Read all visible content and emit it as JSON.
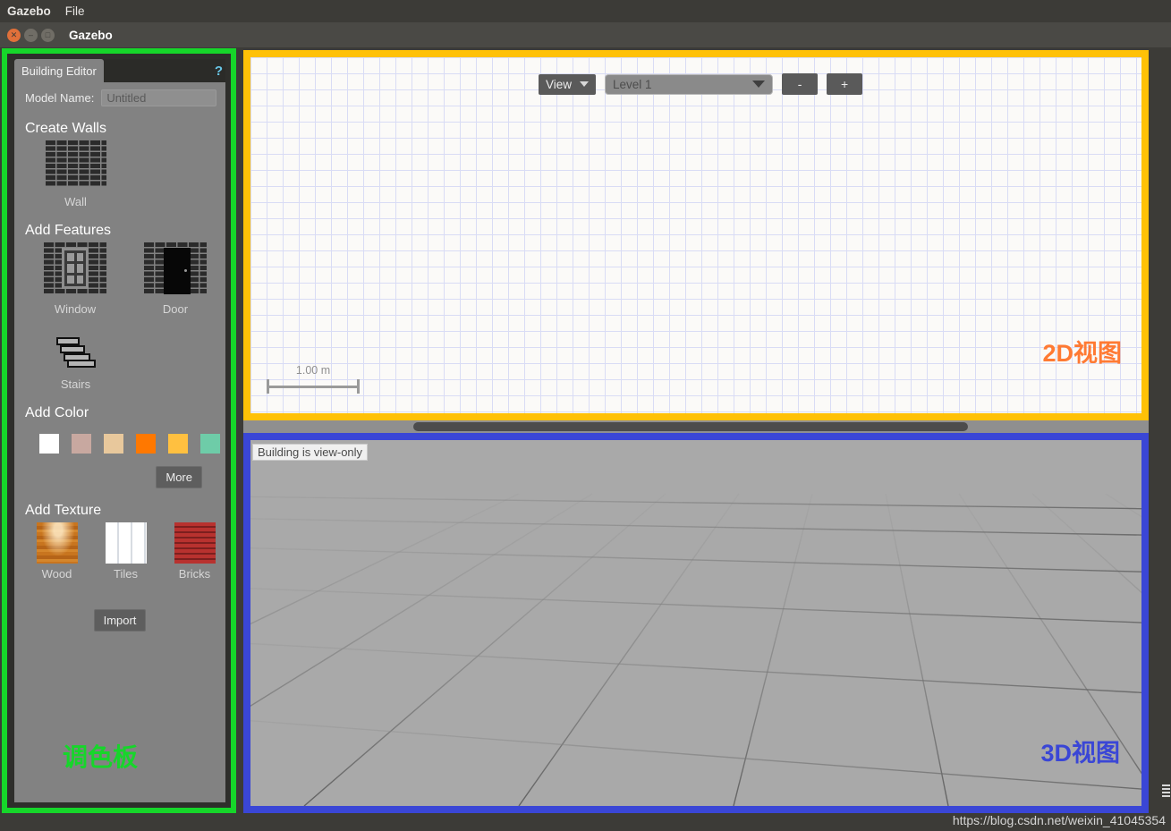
{
  "menubar": {
    "app": "Gazebo",
    "file": "File"
  },
  "window": {
    "title": "Gazebo",
    "close_icon": "close-icon",
    "minimize_icon": "minimize-icon",
    "maximize_icon": "maximize-icon"
  },
  "palette": {
    "tab_label": "Building Editor",
    "help_icon": "?",
    "model_name_label": "Model Name:",
    "model_name_value": "Untitled",
    "annotation": "调色板",
    "annotation_color": "#16d62a",
    "sections": {
      "create_walls": {
        "heading": "Create Walls",
        "items": [
          {
            "label": "Wall",
            "icon": "brick-wall-icon"
          }
        ]
      },
      "add_features": {
        "heading": "Add Features",
        "items": [
          {
            "label": "Window",
            "icon": "window-icon"
          },
          {
            "label": "Door",
            "icon": "door-icon"
          },
          {
            "label": "Stairs",
            "icon": "stairs-icon"
          }
        ]
      },
      "add_color": {
        "heading": "Add Color",
        "swatches": [
          "#ffffff",
          "#c8a8a0",
          "#e8c89c",
          "#ff7800",
          "#ffc040",
          "#6ecca8"
        ],
        "more_button": "More"
      },
      "add_texture": {
        "heading": "Add Texture",
        "items": [
          {
            "label": "Wood",
            "icon": "wood-texture-icon"
          },
          {
            "label": "Tiles",
            "icon": "tiles-texture-icon"
          },
          {
            "label": "Bricks",
            "icon": "bricks-texture-icon"
          }
        ],
        "import_button": "Import"
      }
    }
  },
  "view2d": {
    "annotation": "2D视图",
    "annotation_color": "#ff7a33",
    "border_color": "#ffc107",
    "toolbar": {
      "view_button": "View",
      "view_caret_icon": "chevron-down-icon",
      "level_value": "Level 1",
      "level_caret_icon": "chevron-down-icon",
      "zoom_out_button": "-",
      "zoom_in_button": "+"
    },
    "scale_label": "1.00 m"
  },
  "view3d": {
    "annotation": "3D视图",
    "annotation_color": "#3a46d6",
    "border_color": "#3a46d6",
    "status": "Building is view-only"
  },
  "watermark": "https://blog.csdn.net/weixin_41045354"
}
